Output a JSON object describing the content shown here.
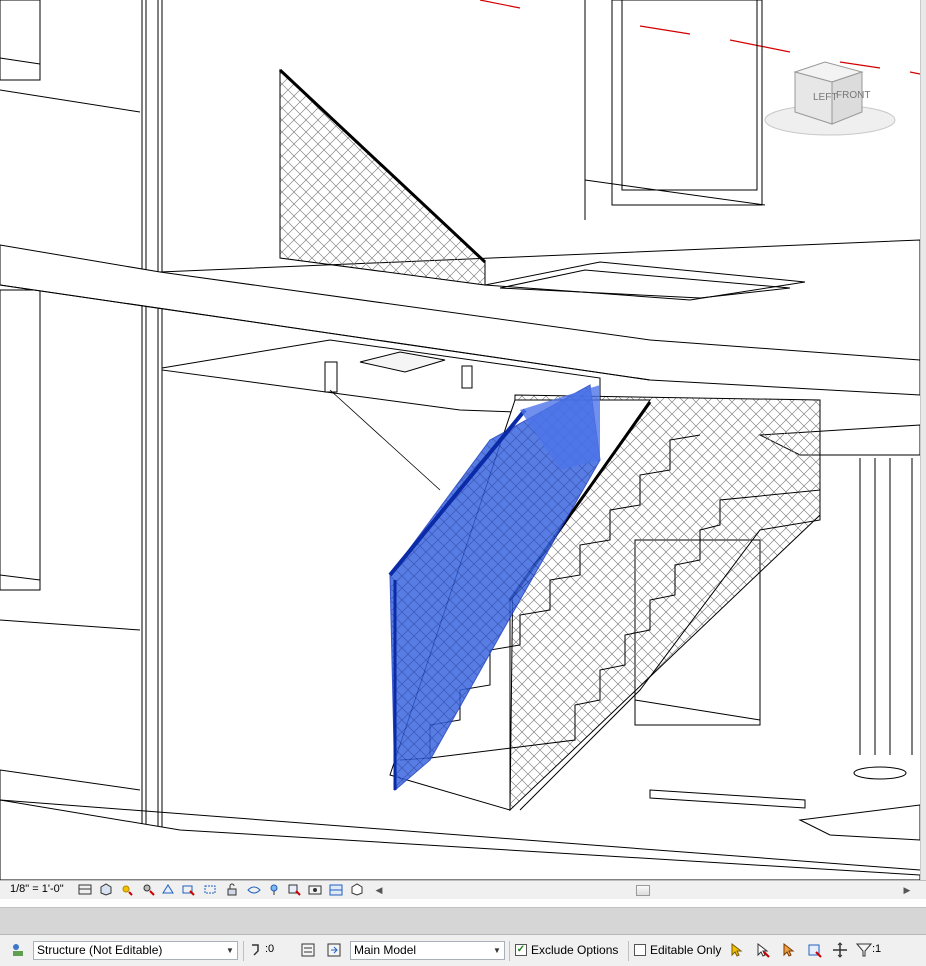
{
  "viewcube": {
    "left_face": "LEFT",
    "front_face": "FRONT"
  },
  "view_control_bar": {
    "scale": "1/8\" = 1'-0\"",
    "icons": [
      "detail-level-icon",
      "visual-style-icon",
      "sun-path-icon",
      "shadows-icon",
      "rendering-icon",
      "crop-view-icon",
      "show-crop-region-icon",
      "unlock-3d-view-icon",
      "temporary-hide-isolate-icon",
      "reveal-hidden-elements-icon",
      "temporary-view-properties-icon",
      "analytical-model-icon",
      "highlight-displacement-icon",
      "reveal-constraints-icon"
    ]
  },
  "status_bar": {
    "workset": "Structure (Not Editable)",
    "editable_count": ":0",
    "design_option": "Main Model",
    "exclude_options_label": "Exclude Options",
    "exclude_options_checked": true,
    "editable_only_label": "Editable Only",
    "editable_only_checked": false,
    "filter_count": ":1"
  },
  "colors": {
    "selection_blue": "#1f4fd6",
    "gridline_red": "#d40000",
    "chrome_gray": "#d6d6d6",
    "status_bg": "#f0f0f0"
  }
}
